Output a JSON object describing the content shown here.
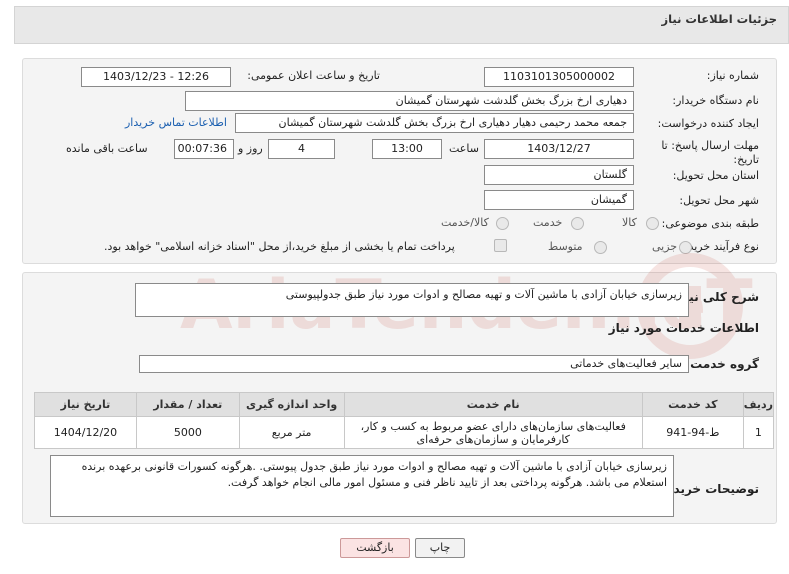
{
  "header": {
    "title": "جزئیات اطلاعات نیاز"
  },
  "fields": {
    "need_number_label": "شماره نیاز:",
    "need_number": "1103101305000002",
    "announce_label": "تاریخ و ساعت اعلان عمومی:",
    "announce_value": "1403/12/23 - 12:26",
    "buyer_org_label": "نام دستگاه خریدار:",
    "buyer_org": "دهیاری ارخ بزرگ بخش گلدشت شهرستان گمیشان",
    "creator_label": "ایجاد کننده درخواست:",
    "creator": "جمعه محمد رحیمی دهیار دهیاری ارخ بزرگ بخش گلدشت شهرستان گمیشان",
    "contact_link": "اطلاعات تماس خریدار",
    "deadline_label": "مهلت ارسال پاسخ: تا تاریخ:",
    "deadline_date": "1403/12/27",
    "time_label": "ساعت",
    "deadline_time": "13:00",
    "days_value": "4",
    "days_label": "روز و",
    "remaining_value": "00:07:36",
    "remaining_label": "ساعت باقی مانده",
    "province_label": "استان محل تحویل:",
    "province": "گلستان",
    "city_label": "شهر محل تحویل:",
    "city": "گمیشان",
    "category_label": "طبقه بندی موضوعی:",
    "category_options": [
      "کالا",
      "خدمت",
      "کالا/خدمت"
    ],
    "process_label": "نوع فرآیند خرید :",
    "process_options": [
      "جزیی",
      "متوسط"
    ],
    "payment_note": "پرداخت تمام یا بخشی از مبلغ خرید،از محل \"اسناد خزانه اسلامی\" خواهد بود."
  },
  "description": {
    "label": "شرح کلی نیاز:",
    "text": "زیرسازی خیابان آزادی با  ماشین آلات و تهیه مصالح و ادوات مورد نیاز  طبق جدولپیوستی"
  },
  "services": {
    "section_title": "اطلاعات خدمات مورد نیاز",
    "group_label": "گروه خدمت:",
    "group_value": "سایر فعالیت‌های خدماتی",
    "columns": [
      "ردیف",
      "کد خدمت",
      "نام خدمت",
      "واحد اندازه گیری",
      "تعداد / مقدار",
      "تاریخ نیاز"
    ],
    "rows": [
      {
        "row": "1",
        "code": "ط-94-941",
        "name": "فعالیت‌های سازمان‌های دارای عضو مربوط به کسب و کار، کارفرمایان و سازمان‌های حرفه‌ای",
        "unit": "متر مربع",
        "qty": "5000",
        "date": "1404/12/20"
      }
    ]
  },
  "buyer_notes": {
    "label": "توضیحات خریدار:",
    "text": "زیرسازی خیابان آزادی با  ماشین آلات و تهیه مصالح و ادوات مورد نیاز  طبق جدول پیوستی. .هرگونه کسورات قانونی برعهده برنده استعلام می باشد. هرگونه پرداختی بعد از تایید ناظر فنی و مسئول امور مالی انجام خواهد گرفت."
  },
  "buttons": {
    "print": "چاپ",
    "back": "بازگشت"
  },
  "watermark": {
    "text": "AriaTender.neT"
  },
  "colors": {
    "link": "#1b5fb0",
    "back_button_bg": "#fbe3e3",
    "watermark": "#c0392b"
  }
}
